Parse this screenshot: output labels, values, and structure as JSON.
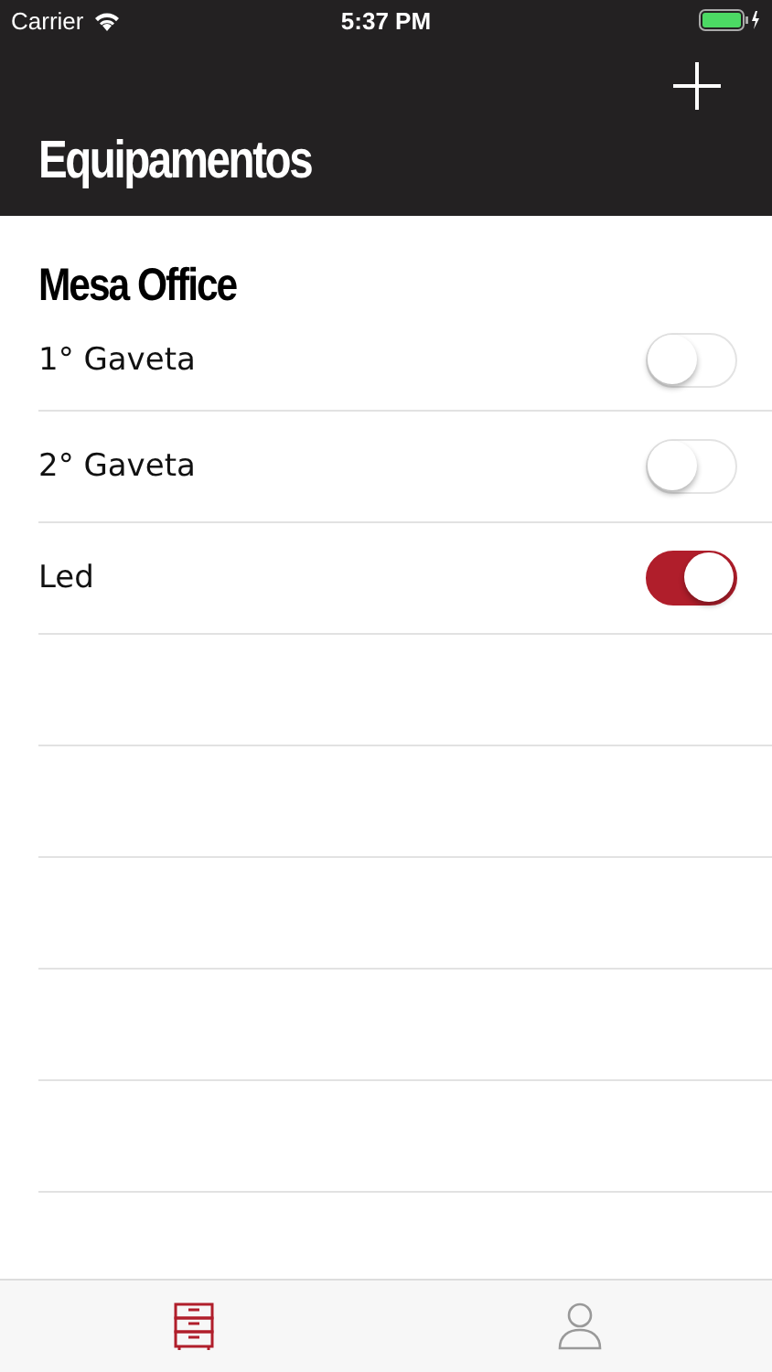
{
  "status_bar": {
    "carrier": "Carrier",
    "time": "5:37 PM"
  },
  "nav_bar": {
    "title": "Equipamentos"
  },
  "section": {
    "title": "Mesa Office"
  },
  "rows": [
    {
      "label": "1° Gaveta",
      "on": false
    },
    {
      "label": "2° Gaveta",
      "on": false
    },
    {
      "label": "Led",
      "on": true
    }
  ],
  "tab_bar": {
    "tabs": [
      {
        "kind": "furniture",
        "selected": true
      },
      {
        "kind": "profile",
        "selected": false
      }
    ]
  }
}
